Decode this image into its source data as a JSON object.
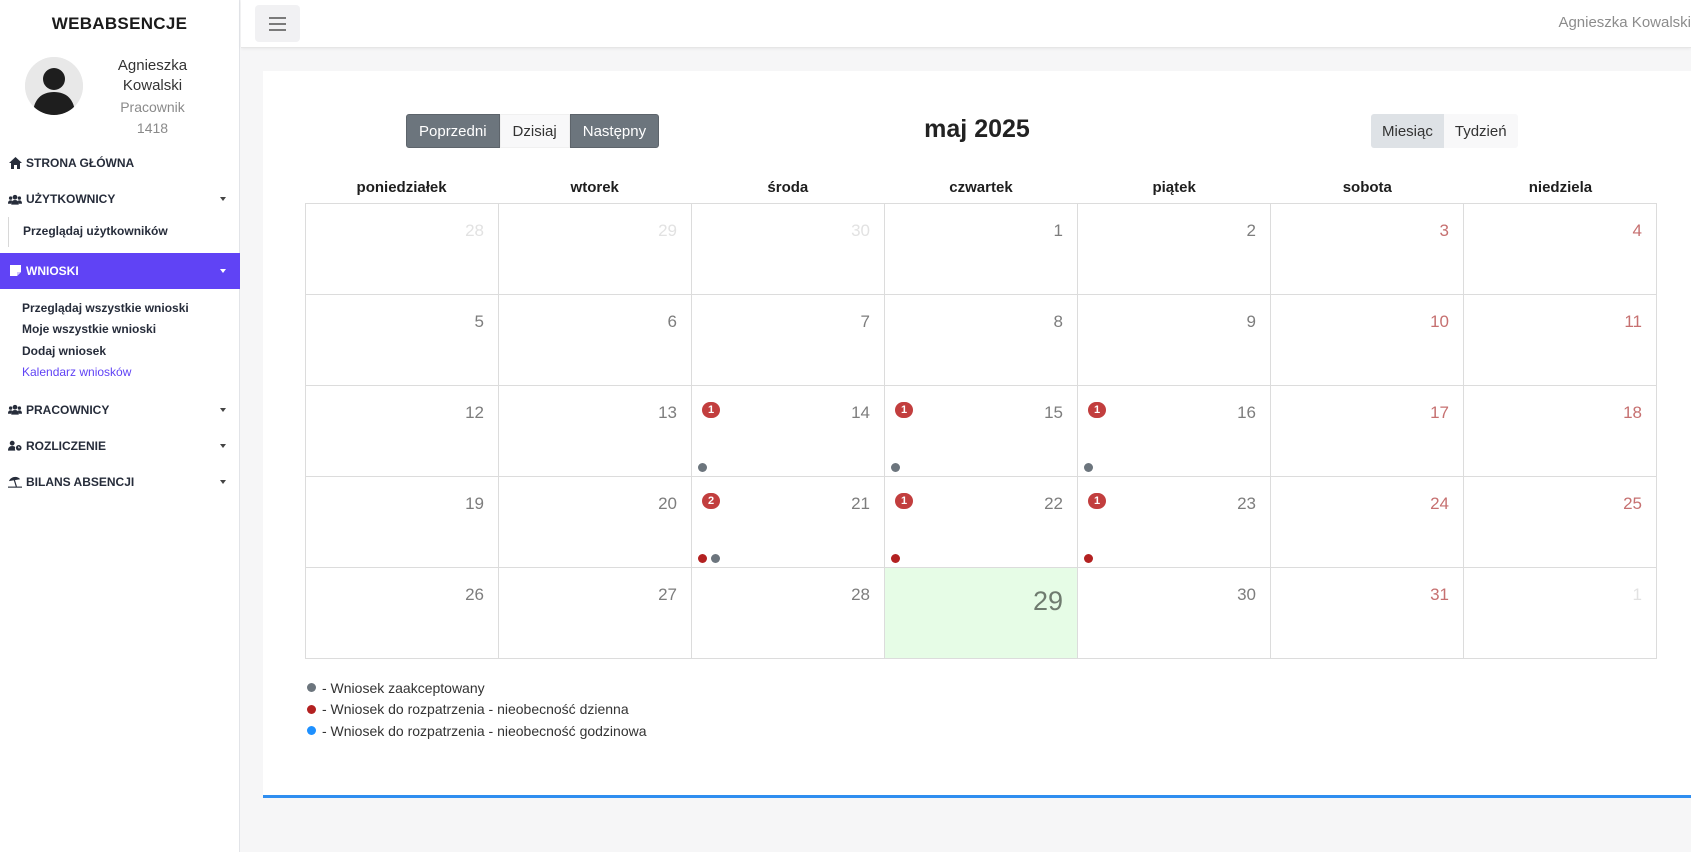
{
  "app": {
    "brand": "WEBABSENCJE"
  },
  "profile": {
    "name": "Agnieszka Kowalski",
    "role": "Pracownik",
    "id": "1418"
  },
  "topbar": {
    "user": "Agnieszka Kowalski"
  },
  "sidebar": {
    "home": "STRONA GŁÓWNA",
    "users": "UŻYTKOWNICY",
    "users_sub": [
      "Przeglądaj użytkowników"
    ],
    "requests": "WNIOSKI",
    "requests_sub": [
      "Przeglądaj wszystkie wnioski",
      "Moje wszystkie wnioski",
      "Dodaj wniosek",
      "Kalendarz wniosków"
    ],
    "employees": "PRACOWNICY",
    "settlement": "ROZLICZENIE",
    "balance": "BILANS ABSENCJI"
  },
  "calendar": {
    "title": "maj 2025",
    "prev": "Poprzedni",
    "today": "Dzisiaj",
    "next": "Następny",
    "view_month": "Miesiąc",
    "view_week": "Tydzień",
    "weekdays": [
      "poniedziałek",
      "wtorek",
      "środa",
      "czwartek",
      "piątek",
      "sobota",
      "niedziela"
    ],
    "weeks": [
      [
        {
          "n": "28",
          "other": true
        },
        {
          "n": "29",
          "other": true
        },
        {
          "n": "30",
          "other": true
        },
        {
          "n": "1"
        },
        {
          "n": "2"
        },
        {
          "n": "3",
          "weekend": true
        },
        {
          "n": "4",
          "weekend": true
        }
      ],
      [
        {
          "n": "5"
        },
        {
          "n": "6"
        },
        {
          "n": "7"
        },
        {
          "n": "8"
        },
        {
          "n": "9"
        },
        {
          "n": "10",
          "weekend": true
        },
        {
          "n": "11",
          "weekend": true
        }
      ],
      [
        {
          "n": "12"
        },
        {
          "n": "13"
        },
        {
          "n": "14",
          "badge": "1",
          "dots": [
            "gray"
          ]
        },
        {
          "n": "15",
          "badge": "1",
          "dots": [
            "gray"
          ]
        },
        {
          "n": "16",
          "badge": "1",
          "dots": [
            "gray"
          ]
        },
        {
          "n": "17",
          "weekend": true
        },
        {
          "n": "18",
          "weekend": true
        }
      ],
      [
        {
          "n": "19"
        },
        {
          "n": "20"
        },
        {
          "n": "21",
          "badge": "2",
          "dots": [
            "red",
            "gray"
          ]
        },
        {
          "n": "22",
          "badge": "1",
          "dots": [
            "red"
          ]
        },
        {
          "n": "23",
          "badge": "1",
          "dots": [
            "red"
          ]
        },
        {
          "n": "24",
          "weekend": true
        },
        {
          "n": "25",
          "weekend": true
        }
      ],
      [
        {
          "n": "26"
        },
        {
          "n": "27"
        },
        {
          "n": "28"
        },
        {
          "n": "29",
          "today": true
        },
        {
          "n": "30"
        },
        {
          "n": "31",
          "weekend": true
        },
        {
          "n": "1",
          "other": true
        }
      ]
    ]
  },
  "legend": [
    {
      "color": "gray",
      "text": "- Wniosek zaakceptowany"
    },
    {
      "color": "red",
      "text": "- Wniosek do rozpatrzenia - nieobecność dzienna"
    },
    {
      "color": "blue",
      "text": "- Wniosek do rozpatrzenia - nieobecność godzinowa"
    }
  ],
  "colors": {
    "accent": "#6043f5",
    "gray_dot": "#6c757d",
    "red_dot": "#b32121",
    "blue_dot": "#1e90ff",
    "badge": "#c23e3e",
    "today_bg": "#e6fce6"
  }
}
